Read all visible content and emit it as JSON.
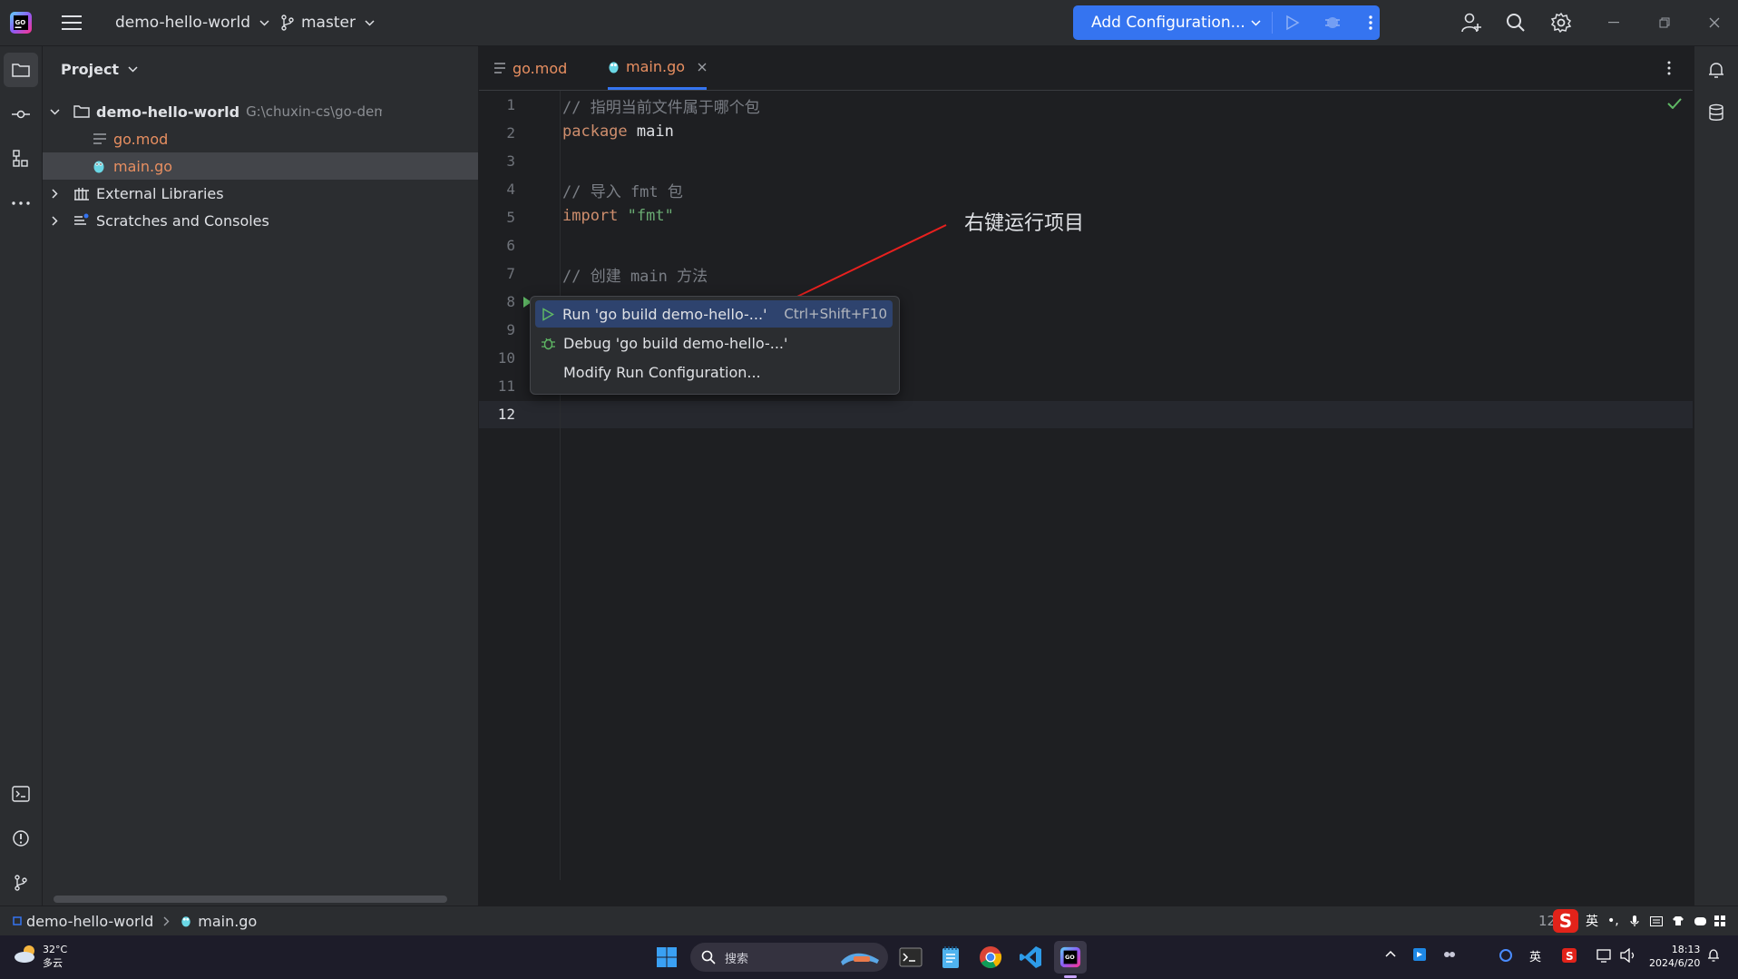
{
  "titlebar": {
    "project_name": "demo-hello-world",
    "branch": "master",
    "run_config": "Add Configuration..."
  },
  "project_panel": {
    "title": "Project",
    "root_name": "demo-hello-world",
    "root_path": "G:\\chuxin-cs\\go-demo\\demo-hello-wo",
    "files": [
      "go.mod",
      "main.go"
    ],
    "external_libraries": "External Libraries",
    "scratches": "Scratches and Consoles"
  },
  "tabs": [
    "go.mod",
    "main.go"
  ],
  "editor": {
    "line_numbers": [
      "1",
      "2",
      "3",
      "4",
      "5",
      "6",
      "7",
      "8",
      "9",
      "10",
      "11",
      "12"
    ],
    "current_line": "12",
    "line1": "// 指明当前文件属于哪个包",
    "line2_kw": "package",
    "line2_id": " main",
    "line4": "// 导入 fmt 包",
    "line5_kw": "import",
    "line5_str": " \"fmt\"",
    "line7": "// 创建 main 方法"
  },
  "annotation": {
    "text": "右键运行项目",
    "color": "#e8201e"
  },
  "context_menu": {
    "run": "Run 'go build demo-hello-...'",
    "run_shortcut": "Ctrl+Shift+F10",
    "debug": "Debug 'go build demo-hello-...'",
    "modify": "Modify Run Configuration..."
  },
  "statusbar": {
    "breadcrumb_project": "demo-hello-world",
    "breadcrumb_file": "main.go",
    "position_partial": "12"
  },
  "taskbar": {
    "temperature": "32°C",
    "weather": "多云",
    "search": "搜索",
    "ime": "英",
    "time": "18:13",
    "date": "2024/6/20"
  },
  "colors": {
    "accent": "#3574f0",
    "keyword": "#cf8e6d",
    "string": "#6aab73",
    "comment": "#7a7e85",
    "file_modified": "#e88f61"
  }
}
